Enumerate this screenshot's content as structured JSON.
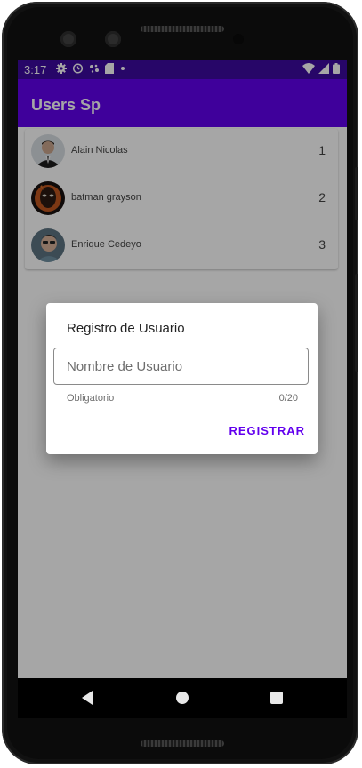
{
  "status_bar": {
    "time": "3:17",
    "icons_left": [
      "gear-icon",
      "alarm-icon",
      "assistant-icon",
      "sd-card-icon",
      "dot-icon"
    ],
    "icons_right": [
      "wifi-icon",
      "signal-icon",
      "battery-icon"
    ]
  },
  "app_bar": {
    "title": "Users Sp"
  },
  "users": [
    {
      "name": "Alain Nicolas",
      "id": "1"
    },
    {
      "name": "batman grayson",
      "id": "2"
    },
    {
      "name": "Enrique Cedeyo",
      "id": "3"
    }
  ],
  "dialog": {
    "title": "Registro de Usuario",
    "input_placeholder": "Nombre de Usuario",
    "helper": "Obligatorio",
    "counter": "0/20",
    "button": "REGISTRAR"
  },
  "colors": {
    "status_bar": "#3c0aa0",
    "app_bar": "#6200ee",
    "accent": "#6200ee"
  }
}
